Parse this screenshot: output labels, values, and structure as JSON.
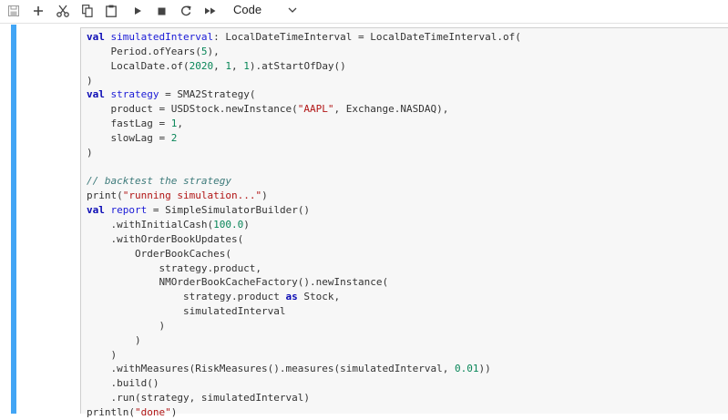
{
  "toolbar": {
    "buttons": [
      {
        "name": "save-button",
        "icon": "save-icon"
      },
      {
        "name": "insert-cell-button",
        "icon": "plus-icon"
      },
      {
        "name": "cut-button",
        "icon": "scissors-icon"
      },
      {
        "name": "copy-button",
        "icon": "copy-icon"
      },
      {
        "name": "paste-button",
        "icon": "clipboard-icon"
      },
      {
        "name": "run-button",
        "icon": "play-icon"
      },
      {
        "name": "interrupt-button",
        "icon": "stop-icon"
      },
      {
        "name": "restart-button",
        "icon": "restart-icon"
      },
      {
        "name": "restart-run-all-button",
        "icon": "fast-forward-icon"
      }
    ],
    "cell_type": "Code",
    "cell_type_icon": "chevron-down-icon"
  },
  "colors": {
    "active_cell_bar": "#42a5f5",
    "code_background": "#f7f7f7",
    "keyword": "#0b0bb5",
    "string": "#b11515",
    "number": "#098658",
    "comment": "#3d7a7a"
  },
  "code": {
    "lines": [
      [
        {
          "t": "val",
          "c": "kwb"
        },
        {
          "t": " "
        },
        {
          "t": "simulatedInterval",
          "c": "vn"
        },
        {
          "t": ": LocalDateTimeInterval = LocalDateTimeInterval.of("
        }
      ],
      [
        {
          "t": "    Period.ofYears("
        },
        {
          "t": "5",
          "c": "num"
        },
        {
          "t": "),"
        }
      ],
      [
        {
          "t": "    LocalDate.of("
        },
        {
          "t": "2020",
          "c": "num"
        },
        {
          "t": ", "
        },
        {
          "t": "1",
          "c": "num"
        },
        {
          "t": ", "
        },
        {
          "t": "1",
          "c": "num"
        },
        {
          "t": ").atStartOfDay()"
        }
      ],
      [
        {
          "t": ")"
        }
      ],
      [
        {
          "t": "val",
          "c": "kwb"
        },
        {
          "t": " "
        },
        {
          "t": "strategy",
          "c": "vn"
        },
        {
          "t": " = SMA2Strategy("
        }
      ],
      [
        {
          "t": "    product = USDStock.newInstance("
        },
        {
          "t": "\"AAPL\"",
          "c": "str"
        },
        {
          "t": ", Exchange.NASDAQ),"
        }
      ],
      [
        {
          "t": "    fastLag = "
        },
        {
          "t": "1",
          "c": "num"
        },
        {
          "t": ","
        }
      ],
      [
        {
          "t": "    slowLag = "
        },
        {
          "t": "2",
          "c": "num"
        }
      ],
      [
        {
          "t": ")"
        }
      ],
      [
        {
          "t": ""
        }
      ],
      [
        {
          "t": "// backtest the strategy",
          "c": "cm"
        }
      ],
      [
        {
          "t": "print("
        },
        {
          "t": "\"running simulation...\"",
          "c": "str"
        },
        {
          "t": ")"
        }
      ],
      [
        {
          "t": "val",
          "c": "kwb"
        },
        {
          "t": " "
        },
        {
          "t": "report",
          "c": "vn"
        },
        {
          "t": " = SimpleSimulatorBuilder()"
        }
      ],
      [
        {
          "t": "    .withInitialCash("
        },
        {
          "t": "100.0",
          "c": "num"
        },
        {
          "t": ")"
        }
      ],
      [
        {
          "t": "    .withOrderBookUpdates("
        }
      ],
      [
        {
          "t": "        OrderBookCaches("
        }
      ],
      [
        {
          "t": "            strategy.product,"
        }
      ],
      [
        {
          "t": "            NMOrderBookCacheFactory().newInstance("
        }
      ],
      [
        {
          "t": "                strategy.product "
        },
        {
          "t": "as",
          "c": "kwb"
        },
        {
          "t": " Stock,"
        }
      ],
      [
        {
          "t": "                simulatedInterval"
        }
      ],
      [
        {
          "t": "            )"
        }
      ],
      [
        {
          "t": "        )"
        }
      ],
      [
        {
          "t": "    )"
        }
      ],
      [
        {
          "t": "    .withMeasures(RiskMeasures().measures(simulatedInterval, "
        },
        {
          "t": "0.01",
          "c": "num"
        },
        {
          "t": "))"
        }
      ],
      [
        {
          "t": "    .build()"
        }
      ],
      [
        {
          "t": "    .run(strategy, simulatedInterval)"
        }
      ],
      [
        {
          "t": "println("
        },
        {
          "t": "\"done\"",
          "c": "str"
        },
        {
          "t": ")"
        }
      ]
    ]
  }
}
